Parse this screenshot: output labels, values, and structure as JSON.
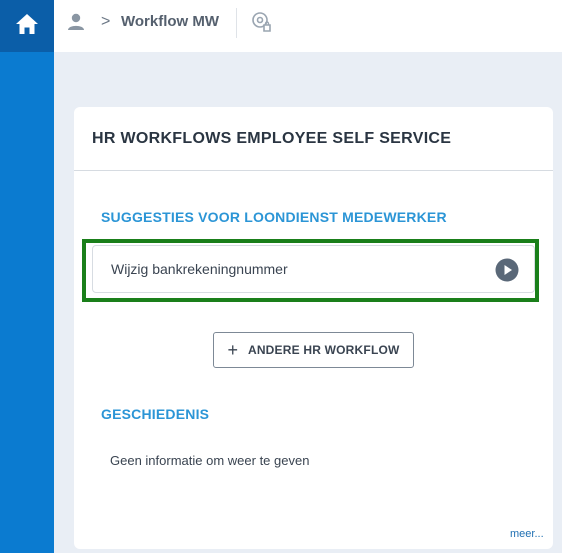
{
  "header": {
    "breadcrumb_chevron": ">",
    "title": "Workflow MW",
    "icons": {
      "home": "home-icon",
      "user": "user-icon",
      "settings": "settings-icon"
    }
  },
  "card": {
    "title": "HR WORKFLOWS EMPLOYEE SELF SERVICE",
    "suggestions_title": "SUGGESTIES VOOR LOONDIENST MEDEWERKER",
    "suggestions": [
      {
        "label": "Wijzig bankrekeningnummer",
        "icon": "play-icon"
      }
    ],
    "other_button": {
      "icon": "+",
      "label": "ANDERE HR WORKFLOW"
    },
    "history_title": "GESCHIEDENIS",
    "history_empty": "Geen informatie om weer te geven",
    "more_link": "meer..."
  },
  "colors": {
    "home_tile": "#0b5ea8",
    "sidebar": "#0b7bd0",
    "accent": "#2b95d6",
    "highlight": "#1a7f1a"
  }
}
